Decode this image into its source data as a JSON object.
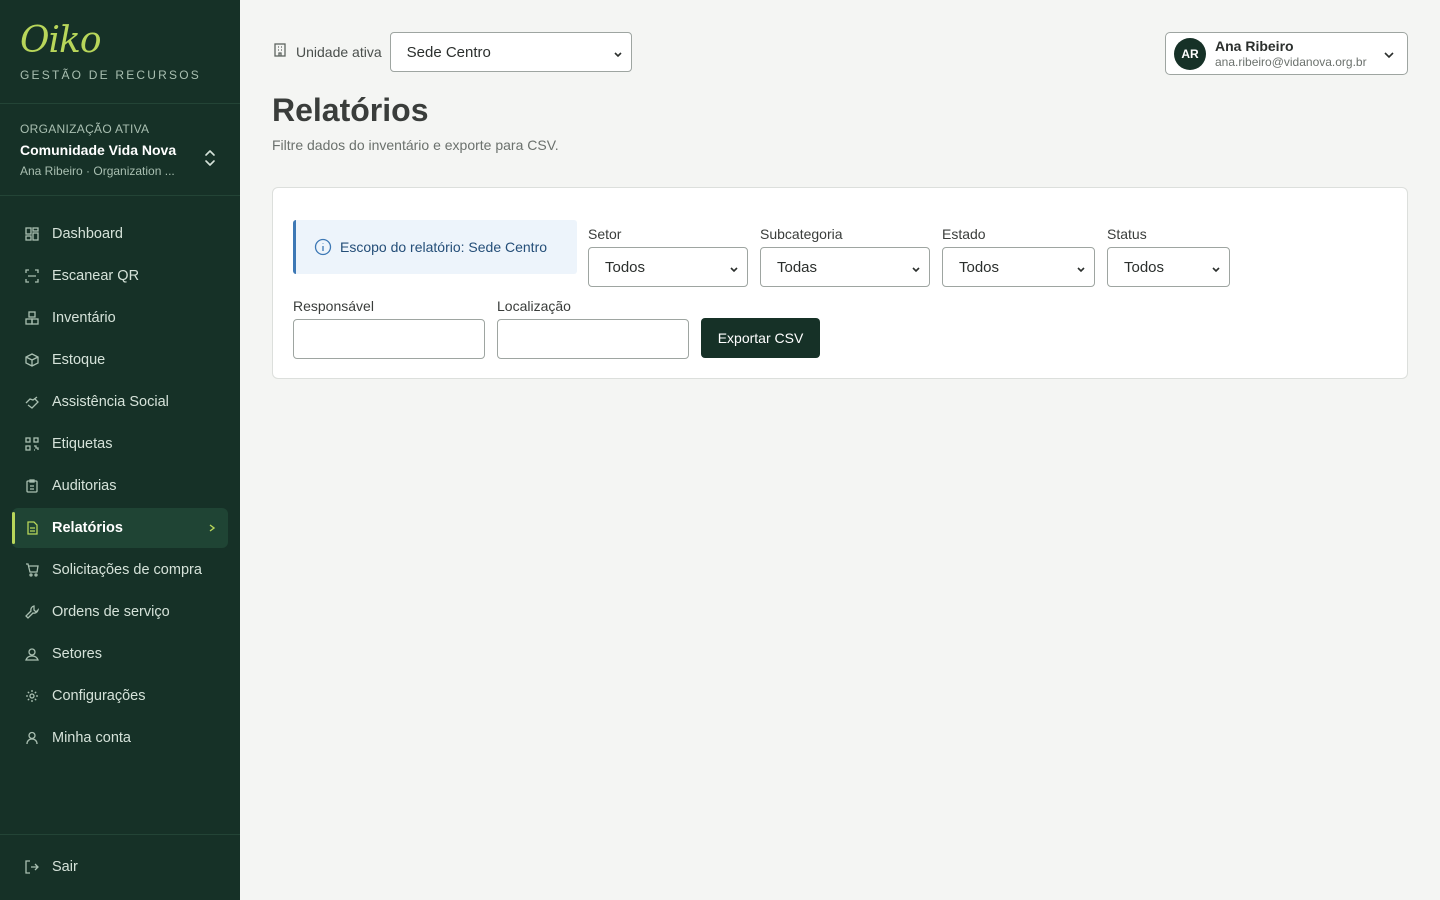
{
  "brand": {
    "logo": "Oiko",
    "subtitle": "GESTÃO DE RECURSOS",
    "accent": "#b8d65a",
    "sidebar_bg": "#163127"
  },
  "org": {
    "label": "ORGANIZAÇÃO ATIVA",
    "name": "Comunidade Vida Nova",
    "meta": "Ana Ribeiro · Organization ..."
  },
  "nav": [
    {
      "label": "Dashboard",
      "icon": "grid-icon"
    },
    {
      "label": "Escanear QR",
      "icon": "scan-icon"
    },
    {
      "label": "Inventário",
      "icon": "boxes-icon"
    },
    {
      "label": "Estoque",
      "icon": "package-icon"
    },
    {
      "label": "Assistência Social",
      "icon": "handshake-icon"
    },
    {
      "label": "Etiquetas",
      "icon": "qr-code-icon"
    },
    {
      "label": "Auditorias",
      "icon": "clipboard-icon"
    },
    {
      "label": "Relatórios",
      "icon": "file-text-icon",
      "active": true
    },
    {
      "label": "Solicitações de compra",
      "icon": "cart-icon"
    },
    {
      "label": "Ordens de serviço",
      "icon": "wrench-icon"
    },
    {
      "label": "Setores",
      "icon": "users-icon"
    },
    {
      "label": "Configurações",
      "icon": "gear-icon"
    },
    {
      "label": "Minha conta",
      "icon": "user-icon"
    }
  ],
  "logout": {
    "label": "Sair",
    "icon": "logout-icon"
  },
  "topbar": {
    "unit_label": "Unidade ativa",
    "unit_value": "Sede Centro"
  },
  "user": {
    "initials": "AR",
    "name": "Ana Ribeiro",
    "email": "ana.ribeiro@vidanova.org.br"
  },
  "page": {
    "title": "Relatórios",
    "subtitle": "Filtre dados do inventário e exporte para CSV."
  },
  "filters": {
    "scope_text": "Escopo do relatório: Sede Centro",
    "setor": {
      "label": "Setor",
      "value": "Todos"
    },
    "subcategoria": {
      "label": "Subcategoria",
      "value": "Todas"
    },
    "estado": {
      "label": "Estado",
      "value": "Todos"
    },
    "status": {
      "label": "Status",
      "value": "Todos"
    },
    "responsavel": {
      "label": "Responsável",
      "value": ""
    },
    "localizacao": {
      "label": "Localização",
      "value": ""
    },
    "export_label": "Exportar CSV"
  }
}
